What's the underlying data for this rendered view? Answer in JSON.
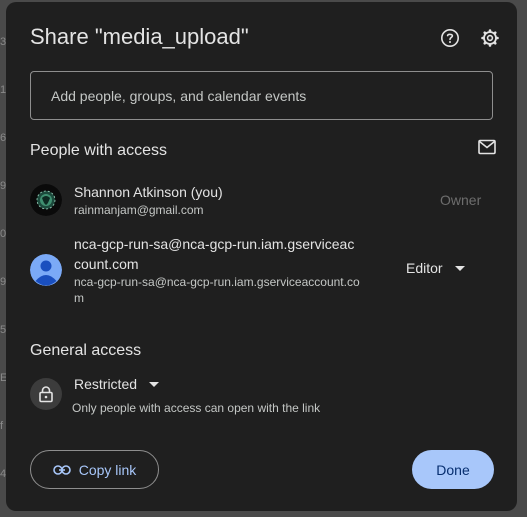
{
  "background": {
    "glyphs": [
      "3e",
      "1",
      "6",
      "9",
      "0c",
      "9",
      "5",
      "E",
      "f",
      "4"
    ]
  },
  "dialog": {
    "title": "Share \"media_upload\"",
    "help_icon": "help-circle-icon",
    "settings_icon": "gear-icon"
  },
  "add_people": {
    "placeholder": "Add people, groups, and calendar events"
  },
  "people_section": {
    "title": "People with access",
    "mail_icon": "mail-icon",
    "people": [
      {
        "name": "Shannon Atkinson (you)",
        "email": "rainmanjam@gmail.com",
        "role": "Owner"
      },
      {
        "name_line1": "nca-gcp-run-sa@nca-gcp-run.iam.gserviceac",
        "name_line2": "count.com",
        "email_line1": "nca-gcp-run-sa@nca-gcp-run.iam.gserviceaccount.co",
        "email_line2": "m",
        "role": "Editor"
      }
    ]
  },
  "general_access": {
    "title": "General access",
    "setting": "Restricted",
    "description": "Only people with access can open with the link"
  },
  "footer": {
    "copy_link_label": "Copy link",
    "done_label": "Done"
  },
  "colors": {
    "dialog_bg": "#1f1f1f",
    "accent": "#a8c7fa",
    "text": "#e3e3e3",
    "muted": "#c4c7c5"
  }
}
